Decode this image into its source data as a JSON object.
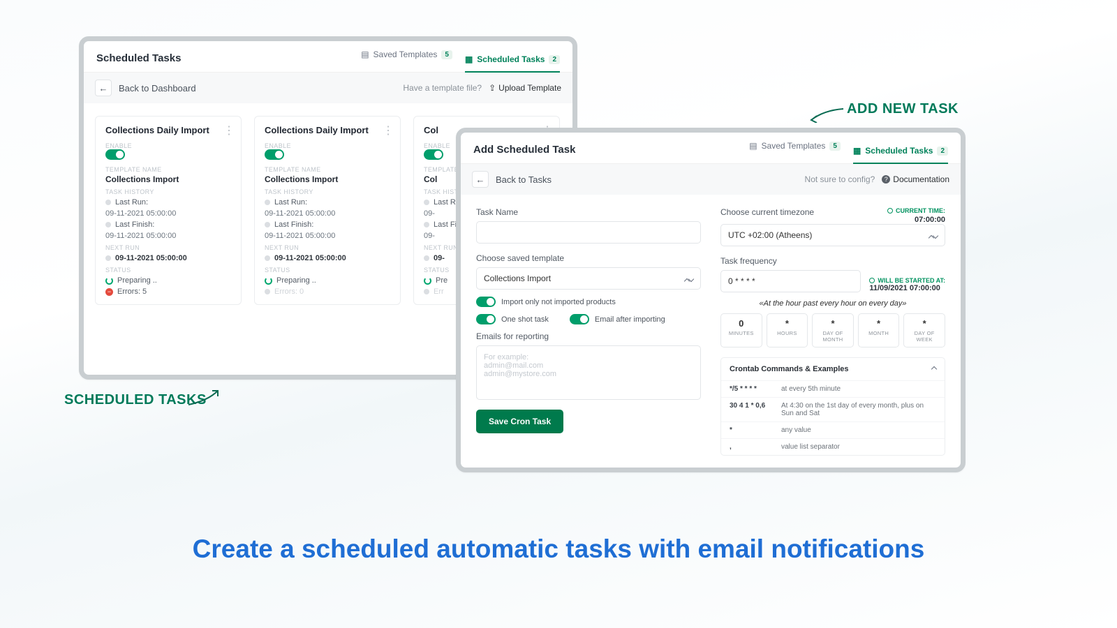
{
  "annotations": {
    "left": "SCHEDULED TASKS",
    "right": "ADD NEW TASK",
    "tagline": "Create a scheduled automatic tasks with email notifications"
  },
  "back_panel": {
    "title": "Scheduled Tasks",
    "tabs": {
      "templates": {
        "label": "Saved Templates",
        "count": "5"
      },
      "scheduled": {
        "label": "Scheduled Tasks",
        "count": "2"
      }
    },
    "subbar": {
      "back_label": "Back to Dashboard",
      "hint": "Have a template file?",
      "upload": "Upload Template"
    },
    "labels": {
      "enable": "ENABLE",
      "template_name": "TEMPLATE NAME",
      "task_history": "TASK HISTORY",
      "last_run": "Last Run:",
      "last_finish": "Last Finish:",
      "next_run": "NEXT RUN",
      "status": "STATUS"
    },
    "cards": [
      {
        "title": "Collections Daily Import",
        "template_name": "Collections Import",
        "last_run": "09-11-2021 05:00:00",
        "last_finish": "09-11-2021 05:00:00",
        "next_run": "09-11-2021 05:00:00",
        "status": "Preparing ..",
        "errors_label": "Errors: 5",
        "has_errors": true
      },
      {
        "title": "Collections Daily Import",
        "template_name": "Collections Import",
        "last_run": "09-11-2021 05:00:00",
        "last_finish": "09-11-2021 05:00:00",
        "next_run": "09-11-2021 05:00:00",
        "status": "Preparing ..",
        "errors_label": "Errors: 0",
        "has_errors": false
      },
      {
        "title": "Col",
        "template_name": "Col",
        "last_run": "09-",
        "last_finish": "09-",
        "next_run": "09-",
        "status": "Pre",
        "errors_label": "Err",
        "has_errors": false
      }
    ]
  },
  "front_panel": {
    "title": "Add Scheduled Task",
    "tabs": {
      "templates": {
        "label": "Saved Templates",
        "count": "5"
      },
      "scheduled": {
        "label": "Scheduled Tasks",
        "count": "2"
      }
    },
    "subbar": {
      "back_label": "Back to Tasks",
      "hint": "Not sure to config?",
      "doc": "Documentation"
    },
    "left": {
      "task_name_label": "Task Name",
      "saved_template_label": "Choose saved template",
      "saved_template_value": "Collections Import",
      "toggle1": "Import only not imported products",
      "toggle2": "One shot task",
      "toggle3": "Email after importing",
      "emails_label": "Emails for reporting",
      "emails_placeholder": "For example:\nadmin@mail.com\nadmin@mystore.com",
      "save_button": "Save Cron Task"
    },
    "right": {
      "timezone_label": "Choose current timezone",
      "current_time_label": "CURRENT TIME:",
      "current_time": "07:00:00",
      "timezone_value": "UTC +02:00 (Atheens)",
      "freq_label": "Task frequency",
      "freq_value": "0 * * * *",
      "start_label": "WILL BE STARTED AT:",
      "start_value": "11/09/2021 07:00:00",
      "human": "«At the hour past every hour on every day»",
      "boxes": [
        {
          "v": "0",
          "u": "MINUTES"
        },
        {
          "v": "*",
          "u": "HOURS"
        },
        {
          "v": "*",
          "u": "DAY OF MONTH"
        },
        {
          "v": "*",
          "u": "MONTH"
        },
        {
          "v": "*",
          "u": "DAY OF WEEK"
        }
      ],
      "cron_title": "Crontab Commands & Examples",
      "cron_rows": [
        {
          "code": "*/5 * * * *",
          "text": "at every 5th minute"
        },
        {
          "code": "30 4 1 * 0,6",
          "text": "At 4:30 on the 1st day of every month, plus on Sun and Sat"
        },
        {
          "code": "*",
          "text": "any value"
        },
        {
          "code": ",",
          "text": "value list separator"
        }
      ]
    }
  }
}
